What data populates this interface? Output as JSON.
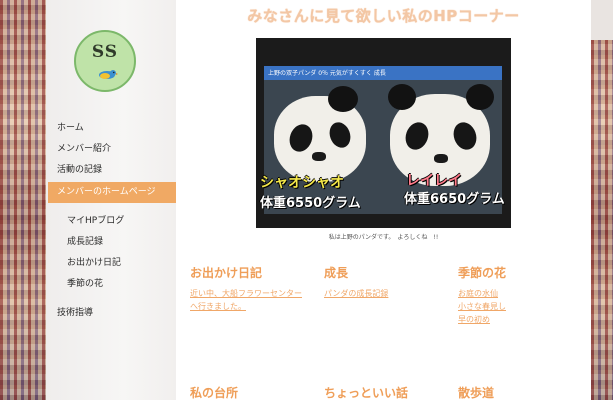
{
  "site": {
    "title": "みなさんに見て欲しい私のHPコーナー"
  },
  "logo": {
    "text": "SS",
    "icon": "bird-icon"
  },
  "nav": {
    "items": [
      {
        "label": "ホーム"
      },
      {
        "label": "メンバー紹介"
      },
      {
        "label": "活動の記録"
      },
      {
        "label": "メンバーのホームページ",
        "active": true
      },
      {
        "label": "マイHPブログ"
      },
      {
        "label": "成長記録"
      },
      {
        "label": "お出かけ日記"
      },
      {
        "label": "季節の花"
      },
      {
        "label": "技術指導"
      }
    ]
  },
  "photo": {
    "tv_banner": "上野の双子パンダ 0％ 元気がすくすく 成長",
    "left_name": "シャオシャオ",
    "left_weight": "体重6550グラム",
    "right_name": "レイレイ",
    "right_weight": "体重6650グラム",
    "caption": "私は上野のパンダです。　よろしくね　!!"
  },
  "sections": [
    {
      "title": "お出かけ日記",
      "links": [
        "近い中、大船フラワーセンターへ行きました。"
      ]
    },
    {
      "title": "成長",
      "links": [
        "パンダの成長記録"
      ]
    },
    {
      "title": "季節の花",
      "links": [
        "お庭の水仙",
        "小さな春見し",
        "早の初め"
      ]
    },
    {
      "title": "私の台所",
      "links": []
    },
    {
      "title": "ちょっといい話",
      "links": []
    },
    {
      "title": "散歩道",
      "links": []
    }
  ],
  "colors": {
    "accent": "#f0a964",
    "title": "#f3c7a5",
    "section_title": "#ef9e58",
    "link": "#f0a768"
  }
}
